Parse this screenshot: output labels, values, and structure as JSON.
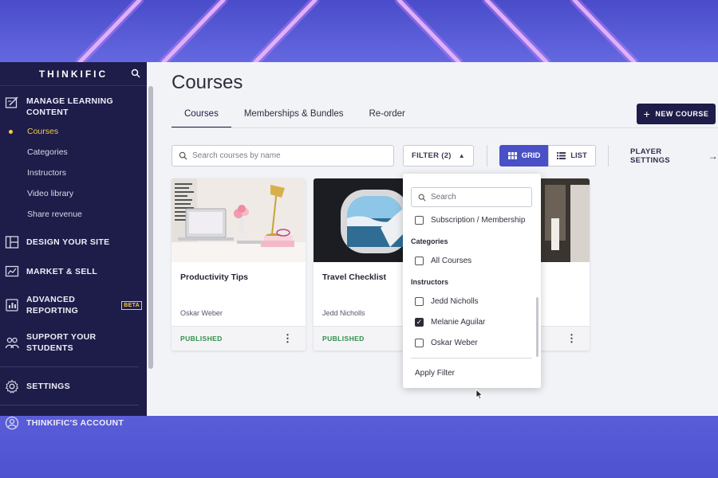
{
  "sidebar": {
    "logo": "THINKIFIC",
    "sections": [
      {
        "label": "MANAGE LEARNING CONTENT",
        "icon": "edit-icon"
      },
      {
        "label": "DESIGN YOUR SITE",
        "icon": "layout-icon"
      },
      {
        "label": "MARKET & SELL",
        "icon": "chart-icon"
      },
      {
        "label": "ADVANCED REPORTING",
        "icon": "report-icon",
        "badge": "BETA"
      },
      {
        "label": "SUPPORT YOUR STUDENTS",
        "icon": "users-icon"
      },
      {
        "label": "SETTINGS",
        "icon": "gear-icon"
      },
      {
        "label": "THINKIFIC'S ACCOUNT",
        "icon": "account-icon"
      }
    ],
    "sub_items": [
      {
        "label": "Courses",
        "active": true
      },
      {
        "label": "Categories"
      },
      {
        "label": "Instructors"
      },
      {
        "label": "Video library"
      },
      {
        "label": "Share revenue"
      }
    ]
  },
  "main": {
    "title": "Courses",
    "tabs": [
      {
        "label": "Courses",
        "active": true
      },
      {
        "label": "Memberships & Bundles"
      },
      {
        "label": "Re-order"
      }
    ],
    "new_course_label": "NEW COURSE",
    "search_placeholder": "Search courses by name",
    "filter_label": "FILTER (2)",
    "grid_label": "GRID",
    "list_label": "LIST",
    "player_settings_label": "PLAYER SETTINGS"
  },
  "courses": [
    {
      "title": "Productivity Tips",
      "author": "Oskar Weber",
      "status": "PUBLISHED"
    },
    {
      "title": "Travel Checklist",
      "author": "Jedd Nicholls",
      "status": "PUBLISHED"
    }
  ],
  "filter_dropdown": {
    "search_placeholder": "Search",
    "membership_option": "Subscription / Membership",
    "categories_heading": "Categories",
    "category_option": "All Courses",
    "instructors_heading": "Instructors",
    "instructors": [
      {
        "name": "Jedd Nicholls",
        "checked": false
      },
      {
        "name": "Melanie Aguilar",
        "checked": true
      },
      {
        "name": "Oskar Weber",
        "checked": false
      }
    ],
    "apply_label": "Apply Filter"
  },
  "colors": {
    "sidebar_bg": "#1e1c48",
    "accent": "#4a50c6",
    "active_nav": "#f4c94a",
    "published": "#2f8f4a",
    "backdrop": "#5b5fd4"
  }
}
